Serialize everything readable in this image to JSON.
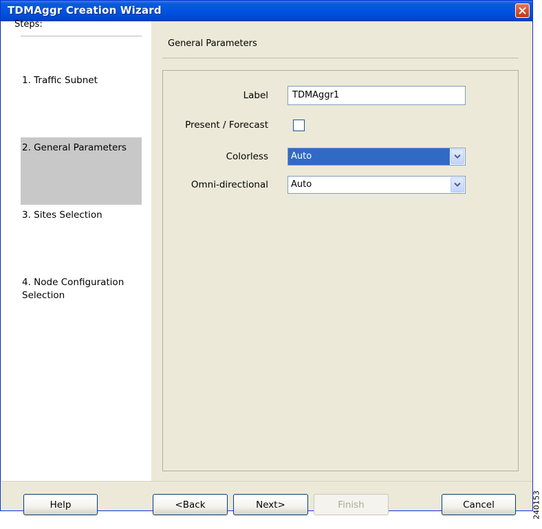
{
  "window": {
    "title": "TDMAggr Creation Wizard"
  },
  "steps": {
    "header": "Steps:",
    "items": [
      {
        "label": "1. Traffic Subnet",
        "active": false
      },
      {
        "label": "2. General Parameters",
        "active": true
      },
      {
        "label": "3. Sites Selection",
        "active": false
      },
      {
        "label": "4. Node Configuration Selection",
        "active": false
      }
    ]
  },
  "main": {
    "header": "General Parameters",
    "fields": {
      "label": {
        "label": "Label",
        "value": "TDMAggr1"
      },
      "present_forecast": {
        "label": "Present / Forecast",
        "checked": false
      },
      "colorless": {
        "label": "Colorless",
        "value": "Auto"
      },
      "omni_directional": {
        "label": "Omni-directional",
        "value": "Auto"
      }
    }
  },
  "buttons": {
    "help": "Help",
    "back": "<Back",
    "next": "Next>",
    "finish": "Finish",
    "cancel": "Cancel"
  },
  "figure_id": "240153",
  "colors": {
    "title_bar": "#0054e3",
    "selection": "#316ac5",
    "active_step": "#c8c8c8"
  }
}
